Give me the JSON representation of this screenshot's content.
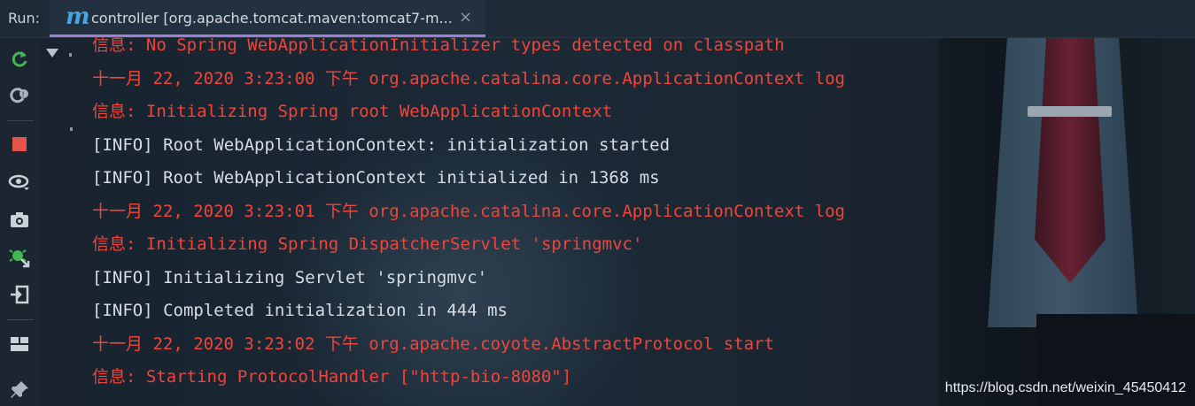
{
  "run": {
    "label": "Run:",
    "tab_title": "controller [org.apache.tomcat.maven:tomcat7-m...",
    "tab_icon": "maven-m-icon",
    "close": "×"
  },
  "toolbar": {
    "icons": [
      "rerun-icon",
      "rerun-failed-icon",
      "stop-icon",
      "view-icon",
      "screenshot-icon",
      "debug-export-icon",
      "exit-icon",
      "layout-icon",
      "pin-icon"
    ]
  },
  "console": {
    "lines": [
      {
        "text": "信息: No Spring WebApplicationInitializer types detected on classpath",
        "color": "#f0453a"
      },
      {
        "text": "十一月 22, 2020 3:23:00 下午 org.apache.catalina.core.ApplicationContext log",
        "color": "#f0453a"
      },
      {
        "text": "信息: Initializing Spring root WebApplicationContext",
        "color": "#f0453a"
      },
      {
        "text": "[INFO] Root WebApplicationContext: initialization started",
        "color": "#d6dde4"
      },
      {
        "text": "[INFO] Root WebApplicationContext initialized in 1368 ms",
        "color": "#d6dde4"
      },
      {
        "text": "十一月 22, 2020 3:23:01 下午 org.apache.catalina.core.ApplicationContext log",
        "color": "#f0453a"
      },
      {
        "text": "信息: Initializing Spring DispatcherServlet 'springmvc'",
        "color": "#f0453a"
      },
      {
        "text": "[INFO] Initializing Servlet 'springmvc'",
        "color": "#d6dde4"
      },
      {
        "text": "[INFO] Completed initialization in 444 ms",
        "color": "#d6dde4"
      },
      {
        "text": "十一月 22, 2020 3:23:02 下午 org.apache.coyote.AbstractProtocol start",
        "color": "#f0453a"
      },
      {
        "text": "信息: Starting ProtocolHandler [\"http-bio-8080\"]",
        "color": "#f0453a"
      }
    ]
  },
  "watermark": "https://blog.csdn.net/weixin_45450412"
}
